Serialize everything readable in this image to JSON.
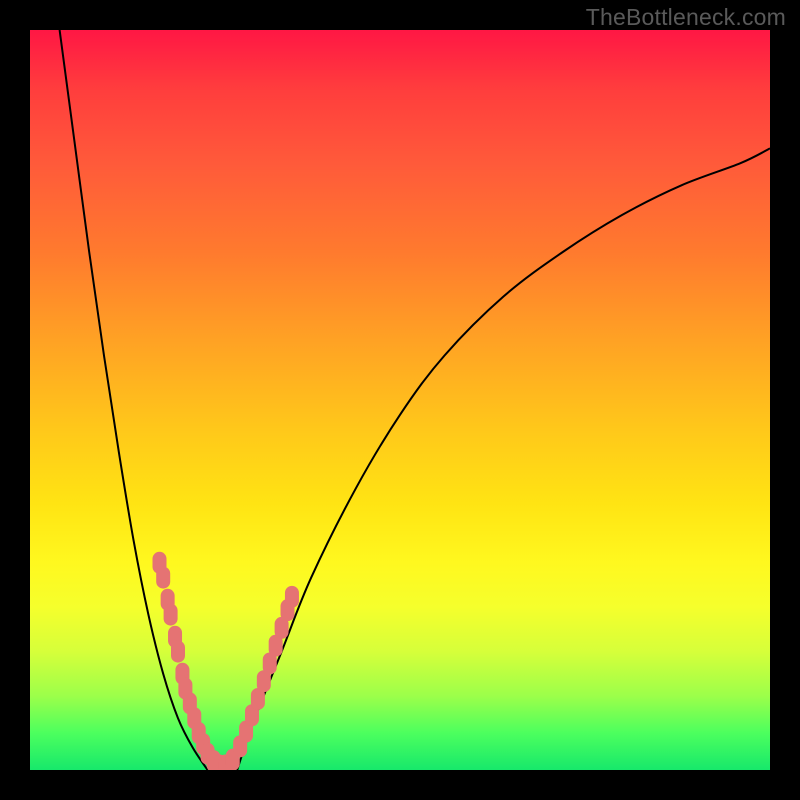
{
  "watermark": "TheBottleneck.com",
  "colors": {
    "frame": "#000000",
    "curve_stroke": "#000000",
    "marker_fill": "#e57373",
    "gradient_top": "#ff1744",
    "gradient_mid": "#ffe413",
    "gradient_bottom": "#17e86b"
  },
  "chart_data": {
    "type": "line",
    "title": "",
    "xlabel": "",
    "ylabel": "",
    "xlim": [
      0,
      100
    ],
    "ylim": [
      0,
      100
    ],
    "note": "Two-branch V-shaped curve over a vertical red→yellow→green gradient. Pink marker clusters lie along both branches near the valley. No axis ticks or numeric labels are rendered; values below are estimated positions in percent of plot width/height (origin bottom-left).",
    "series": [
      {
        "name": "left-branch",
        "x": [
          4,
          6,
          8,
          10,
          12,
          14,
          16,
          18,
          20,
          22,
          24
        ],
        "y": [
          100,
          85,
          70,
          56,
          43,
          31,
          21,
          13,
          7,
          3,
          0
        ]
      },
      {
        "name": "right-branch",
        "x": [
          28,
          30,
          34,
          38,
          44,
          50,
          56,
          64,
          72,
          80,
          88,
          96,
          100
        ],
        "y": [
          0,
          6,
          16,
          26,
          38,
          48,
          56,
          64,
          70,
          75,
          79,
          82,
          84
        ]
      }
    ],
    "markers": {
      "name": "highlighted-points",
      "points": [
        {
          "x": 17.5,
          "y": 28
        },
        {
          "x": 18.0,
          "y": 26
        },
        {
          "x": 18.6,
          "y": 23
        },
        {
          "x": 19.0,
          "y": 21
        },
        {
          "x": 19.6,
          "y": 18
        },
        {
          "x": 20.0,
          "y": 16
        },
        {
          "x": 20.6,
          "y": 13
        },
        {
          "x": 21.0,
          "y": 11
        },
        {
          "x": 21.6,
          "y": 9
        },
        {
          "x": 22.2,
          "y": 7
        },
        {
          "x": 22.8,
          "y": 5
        },
        {
          "x": 23.4,
          "y": 3.5
        },
        {
          "x": 24.0,
          "y": 2.2
        },
        {
          "x": 24.8,
          "y": 1.2
        },
        {
          "x": 25.6,
          "y": 0.6
        },
        {
          "x": 26.4,
          "y": 0.6
        },
        {
          "x": 27.4,
          "y": 1.4
        },
        {
          "x": 28.4,
          "y": 3.2
        },
        {
          "x": 29.2,
          "y": 5.2
        },
        {
          "x": 30.0,
          "y": 7.4
        },
        {
          "x": 30.8,
          "y": 9.6
        },
        {
          "x": 31.6,
          "y": 12.0
        },
        {
          "x": 32.4,
          "y": 14.4
        },
        {
          "x": 33.2,
          "y": 16.8
        },
        {
          "x": 34.0,
          "y": 19.2
        },
        {
          "x": 34.8,
          "y": 21.6
        },
        {
          "x": 35.4,
          "y": 23.4
        }
      ]
    }
  }
}
